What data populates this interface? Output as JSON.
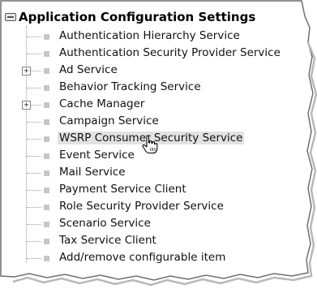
{
  "tree": {
    "title": "Application Configuration Settings",
    "items": [
      {
        "label": "Authentication Hierarchy Service",
        "expandable": false
      },
      {
        "label": "Authentication Security Provider Service",
        "expandable": false
      },
      {
        "label": "Ad Service",
        "expandable": true
      },
      {
        "label": "Behavior Tracking Service",
        "expandable": false
      },
      {
        "label": "Cache Manager",
        "expandable": true
      },
      {
        "label": "Campaign Service",
        "expandable": false
      },
      {
        "label": "WSRP Consumer Security Service",
        "expandable": false,
        "highlighted": true
      },
      {
        "label": "Event Service",
        "expandable": false
      },
      {
        "label": "Mail Service",
        "expandable": false
      },
      {
        "label": "Payment Service Client",
        "expandable": false
      },
      {
        "label": "Role Security Provider Service",
        "expandable": false
      },
      {
        "label": "Scenario Service",
        "expandable": false
      },
      {
        "label": "Tax Service Client",
        "expandable": false
      },
      {
        "label": "Add/remove configurable item",
        "expandable": false
      }
    ],
    "expand_glyph": "+"
  },
  "icons": {
    "title": "collapse-box-icon",
    "cursor": "hand-pointer-icon"
  },
  "colors": {
    "highlight": "#e2e2e2",
    "bullet": "#c6c6c6"
  }
}
